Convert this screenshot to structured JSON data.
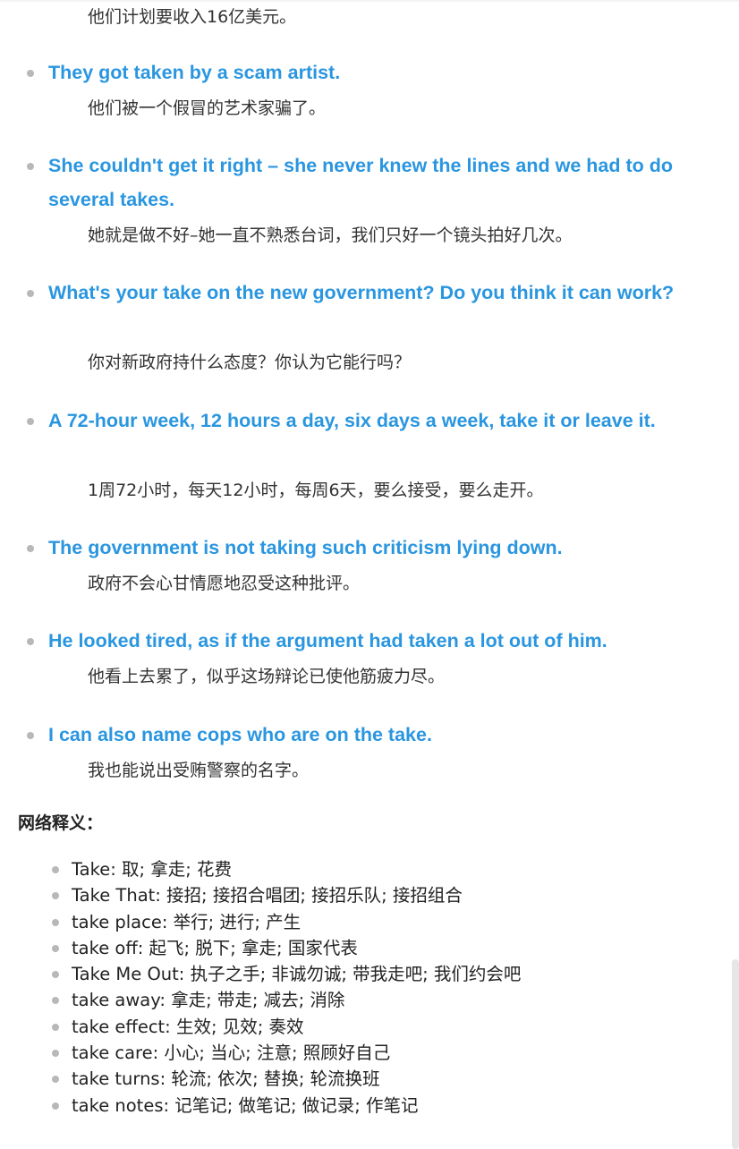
{
  "top_translation": "他们计划要收入16亿美元。",
  "examples": [
    {
      "en": "They got taken by a scam artist.",
      "cn": "他们被一个假冒的艺术家骗了。"
    },
    {
      "en": "She couldn't get it right – she never knew the lines and we had to do several takes.",
      "cn": "她就是做不好–她一直不熟悉台词，我们只好一个镜头拍好几次。"
    },
    {
      "en": "What's your take on the new government? Do you think it can work?",
      "cn": "你对新政府持什么态度？你认为它能行吗？"
    },
    {
      "en": "A 72-hour week, 12 hours a day, six days a week, take it or leave it.",
      "cn": "1周72小时，每天12小时，每周6天，要么接受，要么走开。"
    },
    {
      "en": "The government is not taking such criticism lying down.",
      "cn": "政府不会心甘情愿地忍受这种批评。"
    },
    {
      "en": "He looked tired, as if the argument had taken a lot out of him.",
      "cn": "他看上去累了，似乎这场辩论已使他筋疲力尽。"
    },
    {
      "en": "I can also name cops who are on the take.",
      "cn": "我也能说出受贿警察的名字。"
    }
  ],
  "web_definitions": {
    "heading": "网络释义：",
    "items": [
      "Take: 取; 拿走; 花费",
      "Take That: 接招; 接招合唱团; 接招乐队; 接招组合",
      "take place: 举行; 进行; 产生",
      "take off: 起飞; 脱下; 拿走; 国家代表",
      "Take Me Out: 执子之手; 非诚勿诚; 带我走吧; 我们约会吧",
      "take away: 拿走; 带走; 减去; 消除",
      "take effect: 生效; 见效; 奏效",
      "take care: 小心; 当心; 注意; 照顾好自己",
      "take turns: 轮流; 依次; 替换; 轮流换班",
      "take notes: 记笔记; 做笔记; 做记录; 作笔记"
    ]
  },
  "colors": {
    "english_text": "#2a96e0",
    "bullet": "#b8b8b8"
  }
}
